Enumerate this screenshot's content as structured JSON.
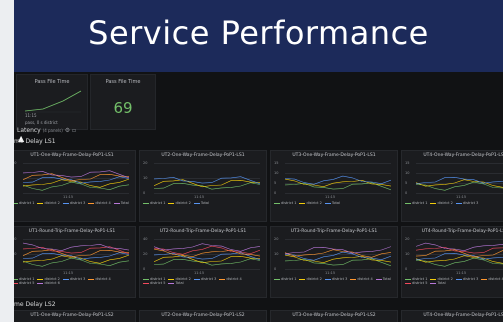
{
  "banner": {
    "title": "Service Performance"
  },
  "stat_panels": [
    {
      "title": "Pass File Time",
      "detail_value": "11:15",
      "detail_label": "pass, 0 s district"
    },
    {
      "title": "Pass File Time",
      "value": "69"
    }
  ],
  "row_bar": {
    "label": "Latency",
    "sub": "(4 panels)"
  },
  "sections": [
    {
      "label": "me Delay LS1"
    },
    {
      "label": "me Delay LS2"
    }
  ],
  "time_label": "11:15",
  "colors": {
    "green": "#73bf69",
    "yellow": "#f2cc0c",
    "blue": "#5794f2",
    "orange": "#ff9830",
    "red": "#f2495c",
    "purple": "#b877d9"
  },
  "panels_row1": [
    {
      "title": "UT1-One-Way-Frame-Delay-PoP1-LS1",
      "yticks": [
        "10",
        "5",
        "0"
      ],
      "legend": [
        {
          "name": "district 1",
          "color": "#73bf69"
        },
        {
          "name": "district 2",
          "color": "#f2cc0c"
        },
        {
          "name": "district 3",
          "color": "#5794f2"
        },
        {
          "name": "district 4",
          "color": "#ff9830"
        },
        {
          "name": "Total",
          "color": "#b877d9"
        }
      ]
    },
    {
      "title": "UT2-One-Way-Frame-Delay-PoP1-LS1",
      "yticks": [
        "20",
        "10",
        "0"
      ],
      "legend": [
        {
          "name": "district 1",
          "color": "#73bf69"
        },
        {
          "name": "district 2",
          "color": "#f2cc0c"
        },
        {
          "name": "Total",
          "color": "#5794f2"
        }
      ]
    },
    {
      "title": "UT3-One-Way-Frame-Delay-PoP1-LS1",
      "yticks": [
        "15",
        "10",
        "5",
        "0"
      ],
      "legend": [
        {
          "name": "district 1",
          "color": "#73bf69"
        },
        {
          "name": "district 2",
          "color": "#f2cc0c"
        },
        {
          "name": "Total",
          "color": "#5794f2"
        }
      ]
    },
    {
      "title": "UT4-One-Way-Frame-Delay-PoP1-LS1",
      "yticks": [
        "15",
        "10",
        "5",
        "0"
      ],
      "legend": [
        {
          "name": "district 1",
          "color": "#73bf69"
        },
        {
          "name": "district 2",
          "color": "#f2cc0c"
        },
        {
          "name": "district 3",
          "color": "#5794f2"
        }
      ]
    }
  ],
  "panels_row2": [
    {
      "title": "UT1-Round-Trip-Frame-Delay-PoP1-LS1",
      "yticks": [
        "20",
        "10",
        "0"
      ],
      "legend": [
        {
          "name": "district 1",
          "color": "#73bf69"
        },
        {
          "name": "district 2",
          "color": "#f2cc0c"
        },
        {
          "name": "district 3",
          "color": "#5794f2"
        },
        {
          "name": "district 4",
          "color": "#ff9830"
        },
        {
          "name": "district 5",
          "color": "#f2495c"
        },
        {
          "name": "district 6",
          "color": "#b877d9"
        }
      ]
    },
    {
      "title": "UT2-Round-Trip-Frame-Delay-PoP1-LS1",
      "yticks": [
        "40",
        "20",
        "0"
      ],
      "legend": [
        {
          "name": "district 1",
          "color": "#73bf69"
        },
        {
          "name": "district 2",
          "color": "#f2cc0c"
        },
        {
          "name": "district 3",
          "color": "#5794f2"
        },
        {
          "name": "district 4",
          "color": "#ff9830"
        },
        {
          "name": "district 5",
          "color": "#f2495c"
        },
        {
          "name": "Total",
          "color": "#b877d9"
        }
      ]
    },
    {
      "title": "UT3-Round-Trip-Frame-Delay-PoP1-LS1",
      "yticks": [
        "20",
        "10",
        "0"
      ],
      "legend": [
        {
          "name": "district 1",
          "color": "#73bf69"
        },
        {
          "name": "district 2",
          "color": "#f2cc0c"
        },
        {
          "name": "district 3",
          "color": "#5794f2"
        },
        {
          "name": "district 4",
          "color": "#ff9830"
        },
        {
          "name": "Total",
          "color": "#b877d9"
        }
      ]
    },
    {
      "title": "UT4-Round-Trip-Frame-Delay-PoP1-LS1",
      "yticks": [
        "20",
        "10",
        "0"
      ],
      "legend": [
        {
          "name": "district 1",
          "color": "#73bf69"
        },
        {
          "name": "district 2",
          "color": "#f2cc0c"
        },
        {
          "name": "district 3",
          "color": "#5794f2"
        },
        {
          "name": "district 4",
          "color": "#ff9830"
        },
        {
          "name": "district 5",
          "color": "#f2495c"
        },
        {
          "name": "Total",
          "color": "#b877d9"
        }
      ]
    }
  ],
  "panels_row3": [
    {
      "title": "UT1-One-Way-Frame-Delay-PoP1-LS2"
    },
    {
      "title": "UT2-One-Way-Frame-Delay-PoP1-LS2"
    },
    {
      "title": "UT3-One-Way-Frame-Delay-PoP1-LS2"
    },
    {
      "title": "UT4-One-Way-Frame-Delay-PoP1-LS2"
    }
  ]
}
